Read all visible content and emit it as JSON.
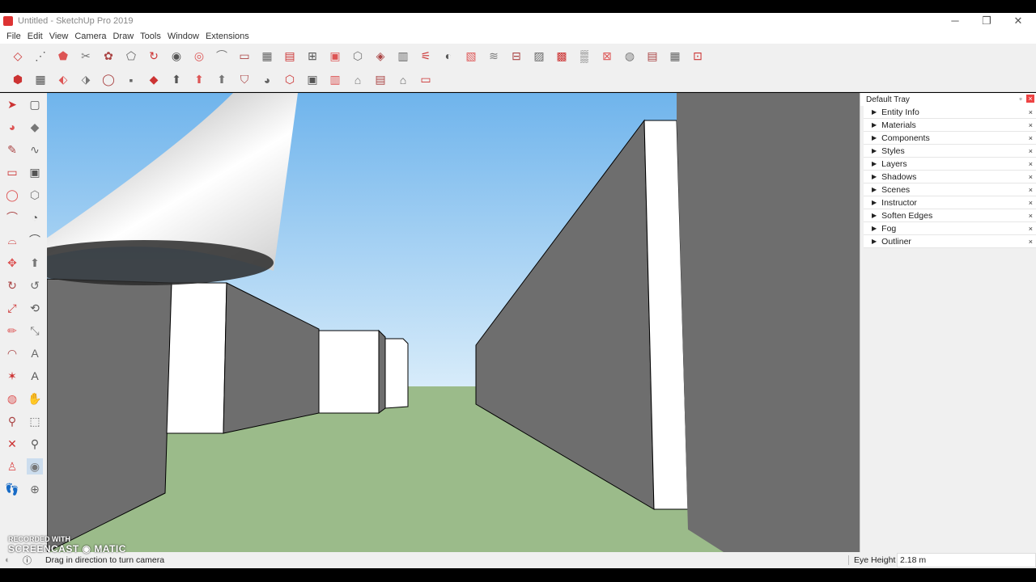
{
  "window": {
    "title": "Untitled - SketchUp Pro 2019",
    "minimize": "─",
    "maximize": "❐",
    "close": "✕"
  },
  "menu": [
    "File",
    "Edit",
    "View",
    "Camera",
    "Draw",
    "Tools",
    "Window",
    "Extensions"
  ],
  "toolbar_row1": [
    "◇",
    "⋰",
    "⬟",
    "✂",
    "✿",
    "⬠",
    "↻",
    "◉",
    "◎",
    "⌒",
    "▭",
    "▦",
    "▤",
    "⊞",
    "▣",
    "⬡",
    "◈",
    "▥",
    "⚟",
    "◐",
    "▧",
    "≋",
    "⊟",
    "▨",
    "▩",
    "▒",
    "⊠",
    "◍",
    "▤",
    "▦",
    "⊡"
  ],
  "toolbar_row2": [
    "⬢",
    "▦",
    "⬖",
    "⬗",
    "◯",
    "▪",
    "◆",
    "⬆",
    "⬆",
    "⬆",
    "⛉",
    "◕",
    "⬡",
    "▣",
    "▥",
    "⌂",
    "▤",
    "⌂",
    "▭"
  ],
  "left_tools": [
    {
      "icon": "select-arrow-icon",
      "glyph": "➤"
    },
    {
      "icon": "make-component-icon",
      "glyph": "▢"
    },
    {
      "icon": "paint-bucket-icon",
      "glyph": "◕"
    },
    {
      "icon": "eraser-icon",
      "glyph": "◆"
    },
    {
      "icon": "line-icon",
      "glyph": "✎"
    },
    {
      "icon": "freehand-icon",
      "glyph": "∿"
    },
    {
      "icon": "rectangle-icon",
      "glyph": "▭"
    },
    {
      "icon": "rotated-rectangle-icon",
      "glyph": "▣"
    },
    {
      "icon": "circle-icon",
      "glyph": "◯"
    },
    {
      "icon": "polygon-icon",
      "glyph": "⬡"
    },
    {
      "icon": "arc-icon",
      "glyph": "⌒"
    },
    {
      "icon": "pie-icon",
      "glyph": "◔"
    },
    {
      "icon": "three-point-arc-icon",
      "glyph": "⌓"
    },
    {
      "icon": "two-point-arc-icon",
      "glyph": "⌒"
    },
    {
      "icon": "move-icon",
      "glyph": "✥"
    },
    {
      "icon": "push-pull-icon",
      "glyph": "⬆"
    },
    {
      "icon": "rotate-icon",
      "glyph": "↻"
    },
    {
      "icon": "follow-me-icon",
      "glyph": "↺"
    },
    {
      "icon": "scale-icon",
      "glyph": "⤢"
    },
    {
      "icon": "offset-icon",
      "glyph": "⟲"
    },
    {
      "icon": "tape-measure-icon",
      "glyph": "✏"
    },
    {
      "icon": "dimension-icon",
      "glyph": "⤡"
    },
    {
      "icon": "protractor-icon",
      "glyph": "◠"
    },
    {
      "icon": "text-icon",
      "glyph": "A"
    },
    {
      "icon": "axes-icon",
      "glyph": "✶"
    },
    {
      "icon": "3d-text-icon",
      "glyph": "A"
    },
    {
      "icon": "orbit-icon",
      "glyph": "◍"
    },
    {
      "icon": "pan-icon",
      "glyph": "✋"
    },
    {
      "icon": "zoom-icon",
      "glyph": "⚲"
    },
    {
      "icon": "zoom-window-icon",
      "glyph": "⬚"
    },
    {
      "icon": "zoom-extents-icon",
      "glyph": "✕"
    },
    {
      "icon": "previous-view-icon",
      "glyph": "⚲"
    },
    {
      "icon": "position-camera-icon",
      "glyph": "♙"
    },
    {
      "icon": "look-around-icon",
      "glyph": "◉"
    },
    {
      "icon": "walk-icon",
      "glyph": "👣"
    },
    {
      "icon": "section-plane-icon",
      "glyph": "⊕"
    }
  ],
  "tray": {
    "title": "Default Tray",
    "panels": [
      "Entity Info",
      "Materials",
      "Components",
      "Styles",
      "Layers",
      "Shadows",
      "Scenes",
      "Instructor",
      "Soften Edges",
      "Fog",
      "Outliner"
    ]
  },
  "status": {
    "text": "Drag in direction to turn camera",
    "measure_label": "Eye Height",
    "measure_value": "2.18 m"
  },
  "watermark": {
    "line1": "RECORDED WITH",
    "line2": "SCREENCAST ◉ MATIC"
  },
  "colors": {
    "sky_top": "#6fb4ec",
    "sky_bottom": "#d8ecfa",
    "ground": "#9bbb8a",
    "wall_gray": "#6e6e6e",
    "wall_white": "#ffffff"
  }
}
